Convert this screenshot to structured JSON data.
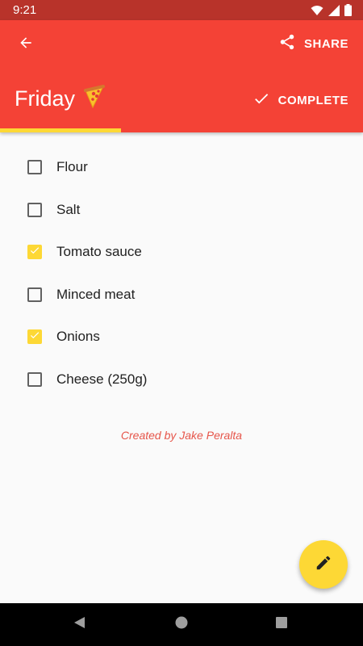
{
  "status_bar": {
    "time": "9:21",
    "icons": [
      "wifi-icon",
      "signal-icon",
      "battery-icon"
    ]
  },
  "toolbar": {
    "back_icon": "arrow-back-icon",
    "share_label": "SHARE",
    "share_icon": "share-icon"
  },
  "header": {
    "title": "Friday",
    "emoji": "🍕",
    "complete_label": "COMPLETE",
    "complete_icon": "check-icon",
    "progress": 0.333
  },
  "items": [
    {
      "label": "Flour",
      "checked": false
    },
    {
      "label": "Salt",
      "checked": false
    },
    {
      "label": "Tomato sauce",
      "checked": true
    },
    {
      "label": "Minced meat",
      "checked": false
    },
    {
      "label": "Onions",
      "checked": true
    },
    {
      "label": "Cheese (250g)",
      "checked": false
    }
  ],
  "footer": {
    "credit": "Created by Jake Peralta"
  },
  "fab": {
    "icon": "edit-pencil-icon"
  },
  "nav": {
    "icons": [
      "nav-back-icon",
      "nav-home-icon",
      "nav-recents-icon"
    ]
  },
  "colors": {
    "primary": "#f44236",
    "primary_dark": "#b8332a",
    "accent": "#fdd835",
    "credit_text": "#e6554a"
  }
}
